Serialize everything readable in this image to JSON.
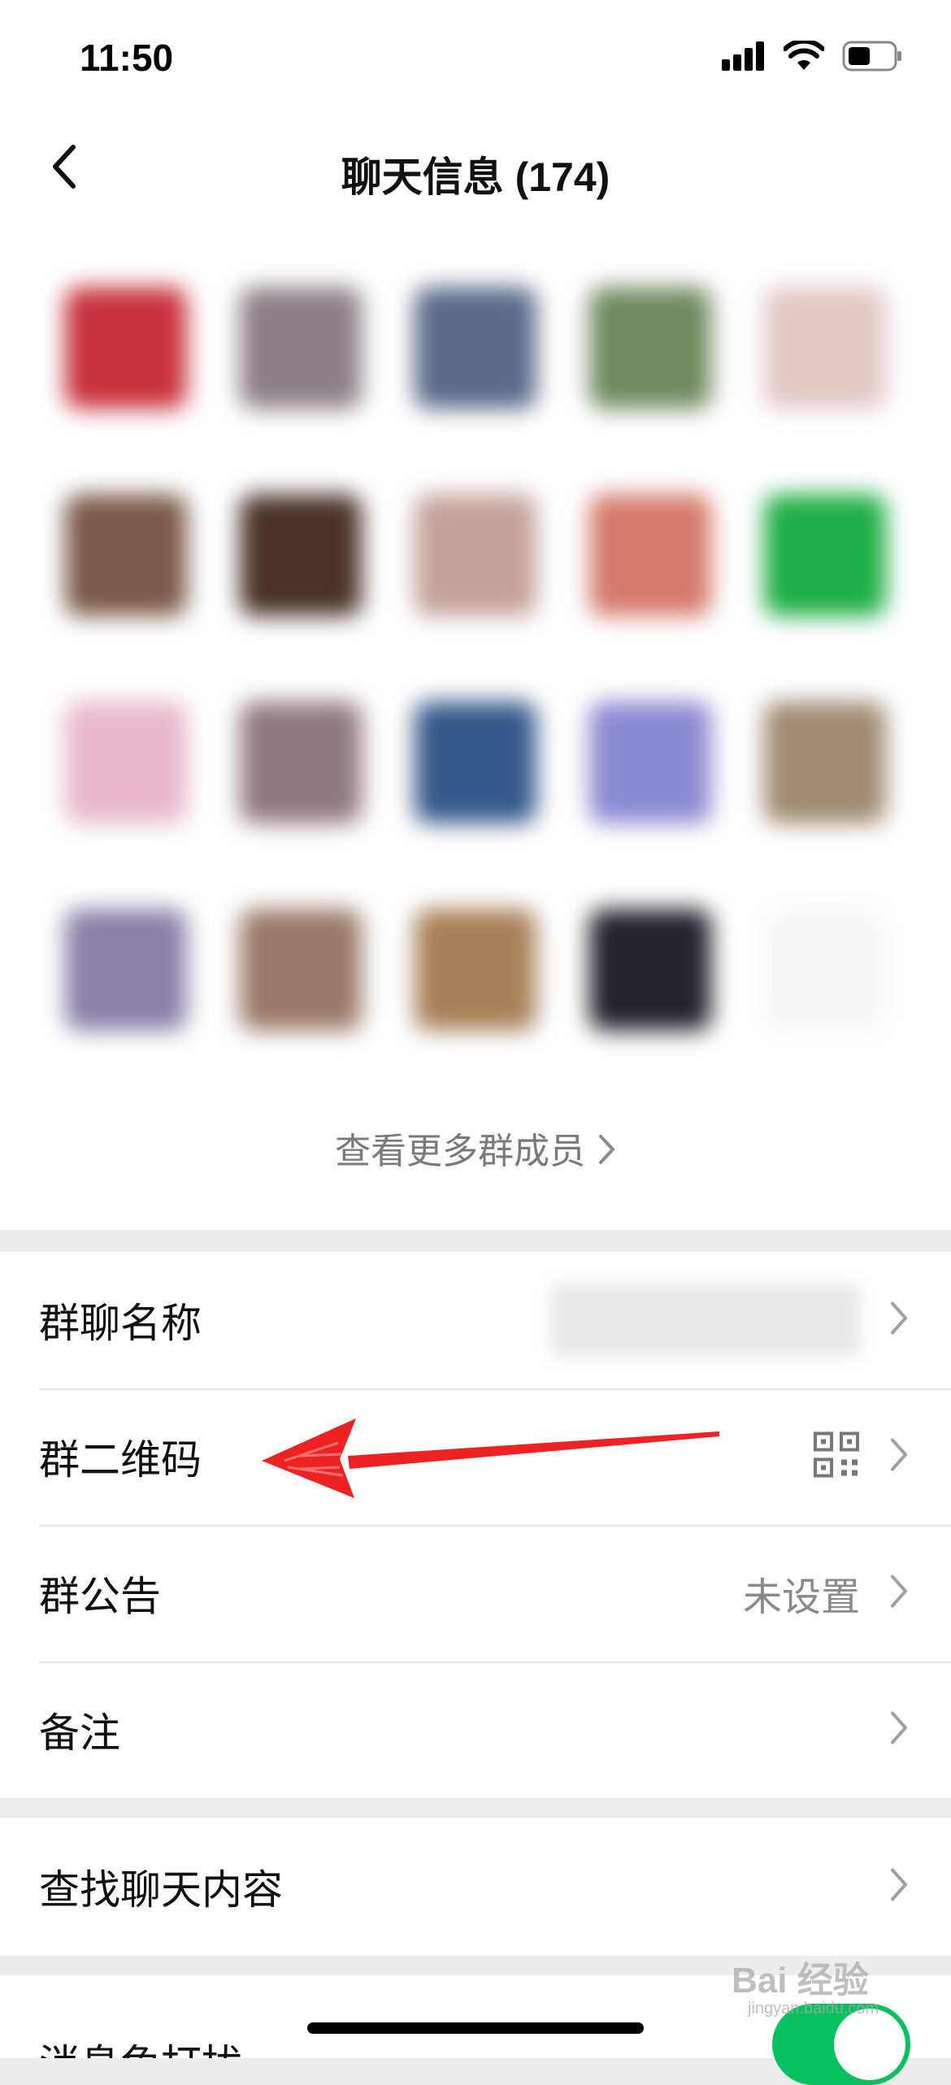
{
  "status_bar": {
    "time": "11:50"
  },
  "nav": {
    "title": "聊天信息 (174)"
  },
  "members": {
    "avatars": [
      "#c8323c",
      "#8d7f88",
      "#5a6a88",
      "#6f8a5e",
      "#e2c8c4",
      "#7a5a48",
      "#4a3228",
      "#c4a29a",
      "#d47a6a",
      "#1fae45",
      "#e8b8cc",
      "#907880",
      "#35598a",
      "#8a8ad0",
      "#a08a70",
      "#8a80a8",
      "#9a7a68",
      "#a88058",
      "#23232e",
      "#f7f7f7"
    ],
    "more_label": "查看更多群成员"
  },
  "group_settings": {
    "name_label": "群聊名称",
    "qr_label": "群二维码",
    "notice_label": "群公告",
    "notice_value": "未设置",
    "remark_label": "备注"
  },
  "search": {
    "label": "查找聊天内容"
  },
  "mute": {
    "label": "消息免打扰",
    "enabled": true
  },
  "watermark": {
    "text": "Bai 经验",
    "sub": "jingyan.baidu.com"
  },
  "colors": {
    "accent_green": "#07c160",
    "annotation_red": "#ee2222"
  }
}
